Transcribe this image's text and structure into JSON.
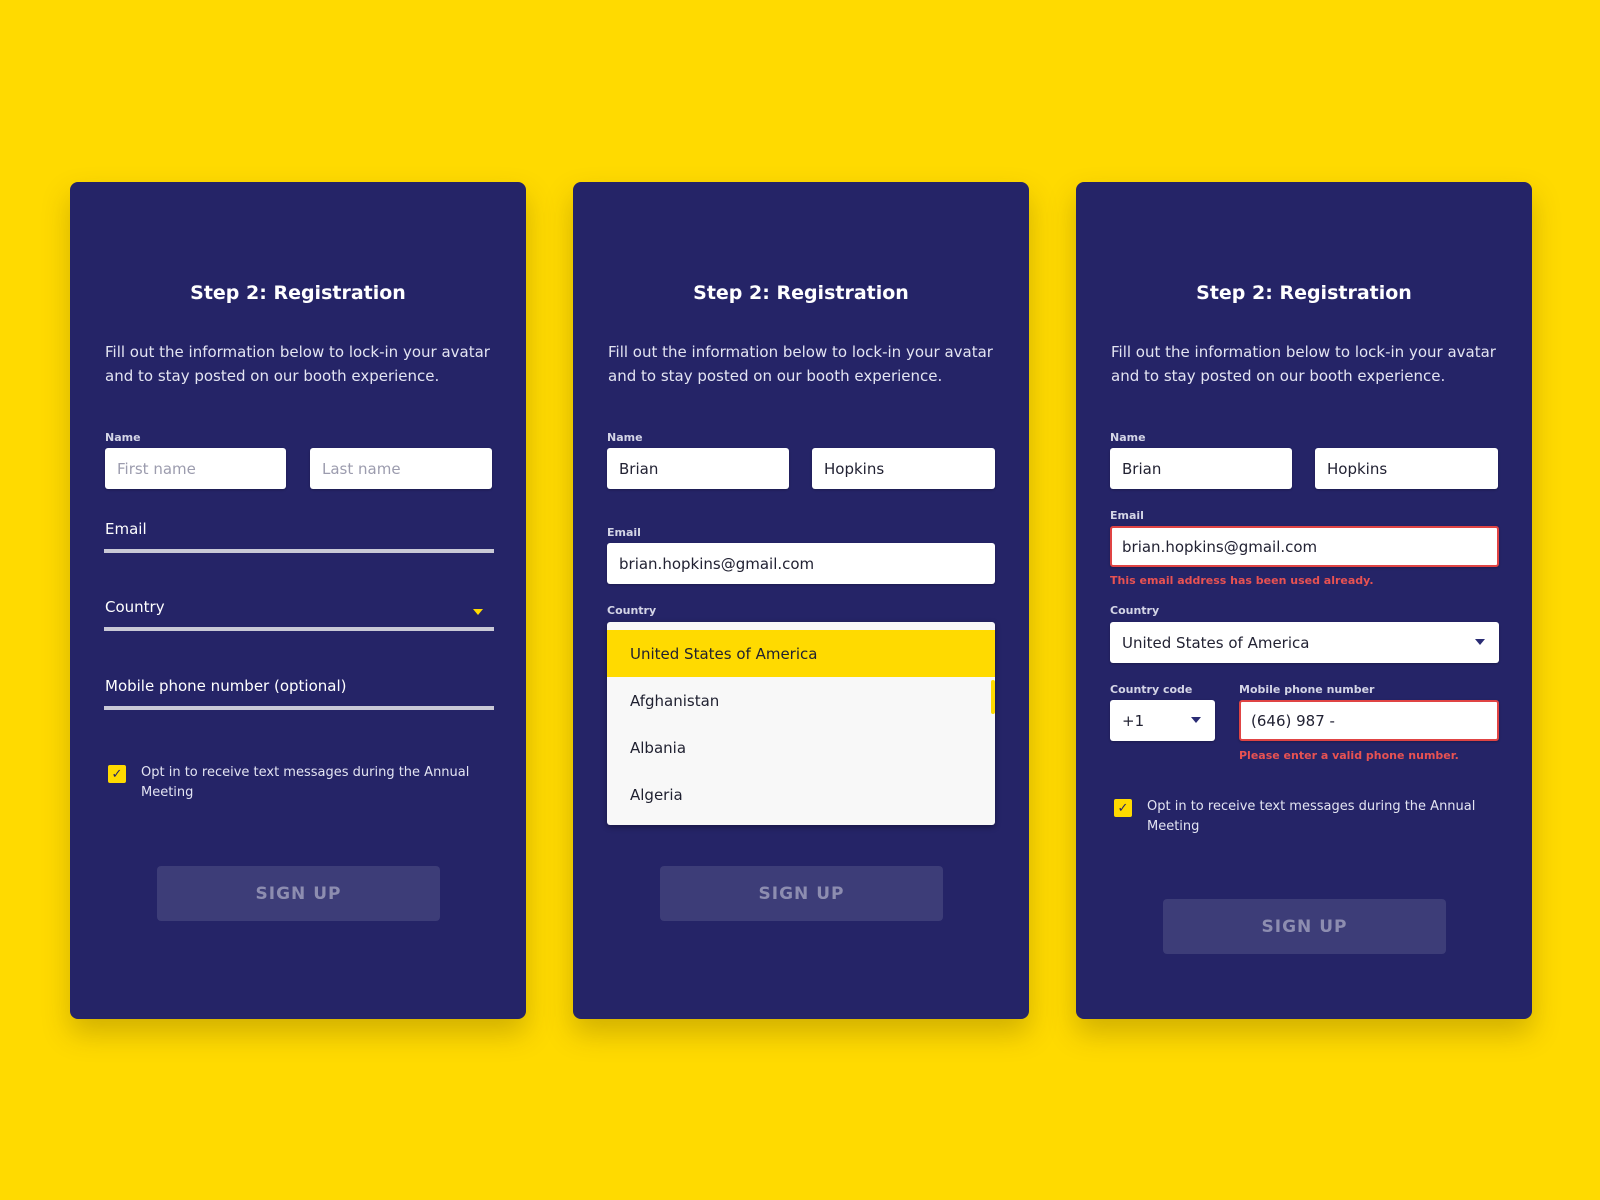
{
  "colors": {
    "background": "#FFDA00",
    "card": "#252467",
    "accent": "#FFDA00",
    "error": "#E85252",
    "button_disabled": "#3D3D78"
  },
  "form": {
    "title": "Step 2: Registration",
    "intro": "Fill out the information below to lock-in your avatar and to stay posted on our booth experience.",
    "name_label": "Name",
    "first_name_placeholder": "First name",
    "last_name_placeholder": "Last name",
    "email_label": "Email",
    "country_label": "Country",
    "phone_label_optional": "Mobile phone number (optional)",
    "country_code_label": "Country code",
    "phone_label": "Mobile phone number",
    "optin_label": "Opt in to receive text messages during the Annual Meeting",
    "checkbox_icon": "check-icon",
    "signup_label": "SIGN UP"
  },
  "screen2": {
    "first_name": "Brian",
    "last_name": "Hopkins",
    "email": "brian.hopkins@gmail.com",
    "country_options": [
      "United States of America",
      "Afghanistan",
      "Albania",
      "Algeria"
    ],
    "selected_option": "United States of America"
  },
  "screen3": {
    "first_name": "Brian",
    "last_name": "Hopkins",
    "email": "brian.hopkins@gmail.com",
    "email_error": "This email address has been used already.",
    "country": "United States of America",
    "country_code": "+1",
    "phone": "(646) 987 -",
    "phone_error": "Please enter a valid phone number."
  }
}
